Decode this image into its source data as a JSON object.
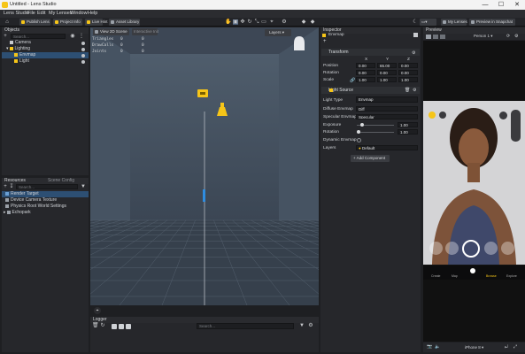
{
  "window": {
    "title": "Untitled - Lens Studio",
    "min": "—",
    "max": "☐",
    "close": "✕"
  },
  "menu": [
    "Lens Studio",
    "File",
    "Edit",
    "My Lenses",
    "Window",
    "Help"
  ],
  "toolbar": {
    "publish": "Publish Lens",
    "project_info": "Project Info",
    "live_hint": "Live Hint",
    "asset_library": "Asset Library",
    "my_lenses": "My Lenses",
    "preview_snapchat": "Preview in Snapchat"
  },
  "objects": {
    "header": "Objects",
    "search_placeholder": "Search...",
    "items": [
      "Camera",
      "Lighting",
      "Envmap",
      "Light"
    ]
  },
  "resources": {
    "header": "Resources",
    "tab2": "Scene Config",
    "search_placeholder": "Search...",
    "items": [
      "Render Target",
      "Device Camera Texture",
      "Physics Root World Settings",
      "Echopark"
    ]
  },
  "viewport": {
    "view_mode": "View 2D Scene",
    "interactive": "Interactive Init",
    "layers": "Layers",
    "stats": [
      {
        "label": "Triangles",
        "a": "0",
        "b": "0"
      },
      {
        "label": "DrawCalls",
        "a": "0",
        "b": "0"
      },
      {
        "label": "Joints",
        "a": "0",
        "b": "0"
      }
    ]
  },
  "logger": {
    "header": "Logger",
    "search_placeholder": "Search..."
  },
  "inspector": {
    "header": "Inspector",
    "object_name": "Envmap",
    "add": "+",
    "transform": {
      "title": "Transform",
      "axes": [
        "X",
        "Y",
        "Z"
      ],
      "position_label": "Position",
      "position": [
        "0,00",
        "65,00",
        "0,00"
      ],
      "rotation_label": "Rotation",
      "rotation": [
        "0,00",
        "0,00",
        "0,00"
      ],
      "scale_label": "Scale",
      "scale": [
        "1,00",
        "1,00",
        "1,00"
      ]
    },
    "light_source": {
      "title": "Light Source",
      "light_type_label": "Light Type",
      "light_type": "Envmap",
      "diffuse_label": "Diffuse Envmap",
      "diffuse": "Diff",
      "specular_label": "Specular Envmap",
      "specular": "Specular",
      "exposure_label": "Exposure",
      "exposure": "1,00",
      "rotation_label": "Rotation",
      "rotation": "1,00",
      "dynamic_label": "Dynamic Envmap",
      "layers_label": "Layers",
      "layers": "Default"
    },
    "add_component": "+ Add Component"
  },
  "preview": {
    "header": "Preview",
    "person": "Person 1",
    "device": "iPhone 8",
    "bottom_nav": [
      "Create",
      "Map",
      "Browse",
      "Explore"
    ]
  },
  "colors": {
    "accent": "#f6c518",
    "selection": "#2d4f73",
    "panel": "#26272b"
  }
}
